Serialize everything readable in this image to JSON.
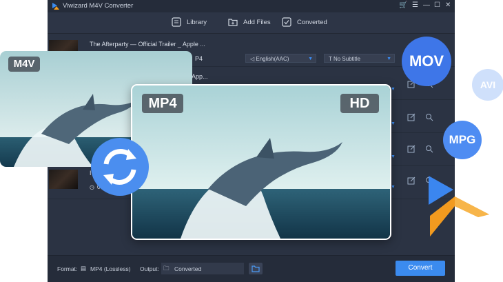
{
  "app": {
    "title": "Viwizard M4V Converter"
  },
  "toolbar": {
    "library": "Library",
    "add_files": "Add Files",
    "converted": "Converted"
  },
  "rows": [
    {
      "title": "The Afterparty — Official Trailer _ Apple ...",
      "format_tail": "P4",
      "audio": "English(AAC)",
      "subtitle": "No Subtitle"
    },
    {
      "title_tail": "App..."
    },
    {},
    {
      "left_char": "I",
      "left_sub": "00"
    }
  ],
  "footer": {
    "format_label": "Format:",
    "format_value": "MP4 (Lossless)",
    "output_label": "Output:",
    "output_value": "Converted",
    "convert": "Convert"
  },
  "overlay": {
    "m4v_tag": "M4V",
    "mp4_tag": "MP4",
    "hd_tag": "HD"
  },
  "badges": {
    "mov": "MOV",
    "avi": "AVI",
    "mpg": "MPG"
  },
  "colors": {
    "accent": "#3b8bef",
    "mov_badge": "#3e76e8",
    "avi_badge": "#cfe0fb",
    "mpg_badge": "#4e8cf2",
    "window_bg": "#2b3343"
  }
}
